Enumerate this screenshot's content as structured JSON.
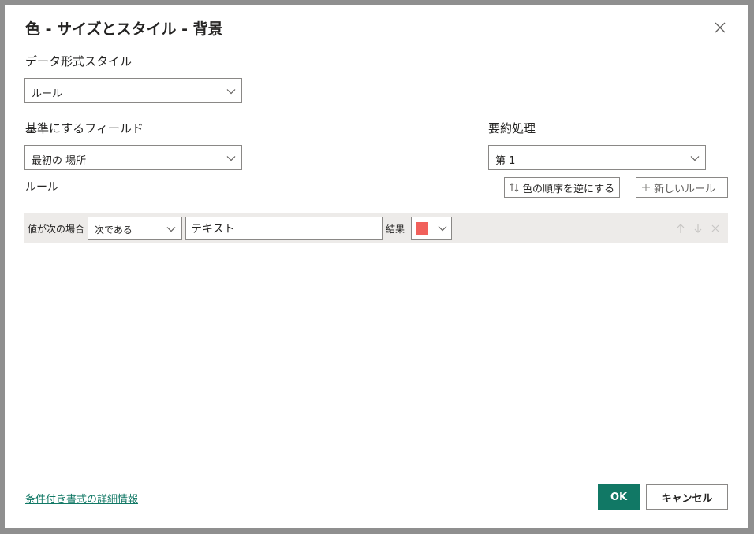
{
  "dialog": {
    "title": "色 - サイズとスタイル - 背景"
  },
  "format_style": {
    "label": "データ形式スタイル",
    "value": "ルール"
  },
  "base_field": {
    "label": "基準にするフィールド",
    "value": "最初の 場所"
  },
  "summarization": {
    "label": "要約処理",
    "value": "第 1"
  },
  "rules": {
    "label": "ルール",
    "reverse_button": "色の順序を逆にする",
    "new_rule_button": "新しいルール",
    "row": {
      "condition_label": "値が次の場合",
      "operator": "次である",
      "value": "テキスト",
      "result_label": "結果",
      "color": "#f1605b"
    }
  },
  "footer": {
    "learn_more_link": "条件付き書式の詳細情報",
    "ok_label": "OK",
    "cancel_label": "キャンセル"
  },
  "colors": {
    "accent": "#117865",
    "row_bg": "#edebe9"
  }
}
